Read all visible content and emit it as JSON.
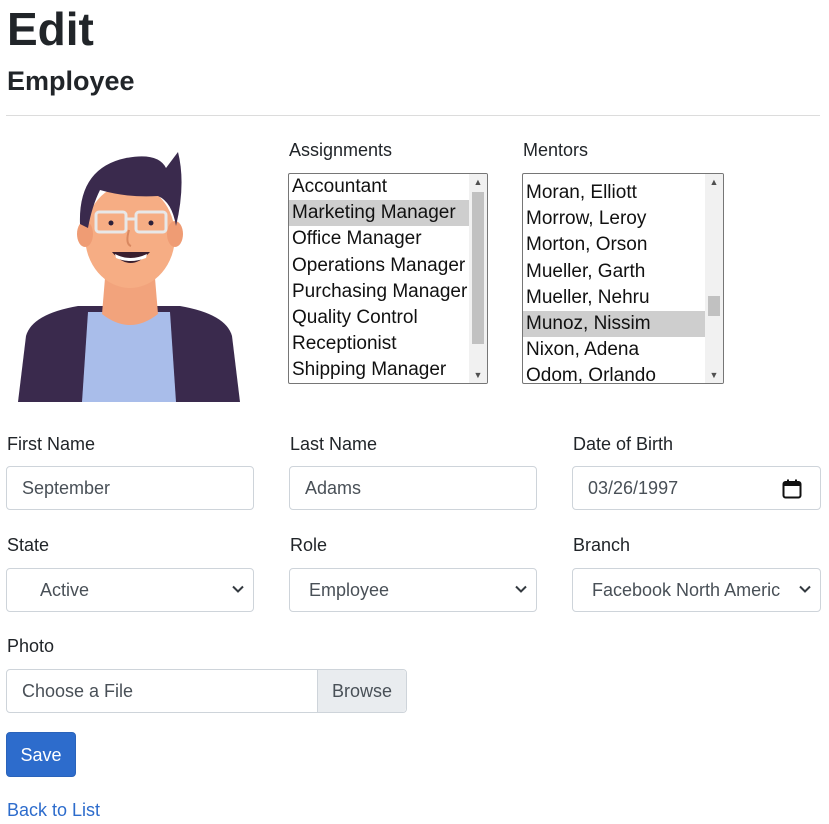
{
  "page": {
    "title": "Edit",
    "subtitle": "Employee"
  },
  "assignments": {
    "label": "Assignments",
    "options": [
      "Accountant",
      "Marketing Manager",
      "Office Manager",
      "Operations Manager",
      "Purchasing Manager",
      "Quality Control",
      "Receptionist",
      "Shipping Manager"
    ],
    "selected": "Marketing Manager"
  },
  "mentors": {
    "label": "Mentors",
    "options": [
      "Moran, Elliott",
      "Morrow, Leroy",
      "Morton, Orson",
      "Mueller, Garth",
      "Mueller, Nehru",
      "Munoz, Nissim",
      "Nixon, Adena",
      "Odom, Orlando"
    ],
    "selected": "Munoz, Nissim"
  },
  "form": {
    "first_name": {
      "label": "First Name",
      "value": "September"
    },
    "last_name": {
      "label": "Last Name",
      "value": "Adams"
    },
    "dob": {
      "label": "Date of Birth",
      "value": "03/26/1997"
    },
    "state": {
      "label": "State",
      "value": "Active"
    },
    "role": {
      "label": "Role",
      "value": "Employee"
    },
    "branch": {
      "label": "Branch",
      "value": "Facebook North Americ"
    },
    "photo": {
      "label": "Photo",
      "placeholder": "Choose a File",
      "browse": "Browse"
    }
  },
  "actions": {
    "save": "Save",
    "back": "Back to List"
  },
  "colors": {
    "primary": "#2d6ccc",
    "selected_option": "#cecece"
  },
  "icons": {
    "calendar": "calendar-icon",
    "chevron": "chevron-down-icon"
  }
}
